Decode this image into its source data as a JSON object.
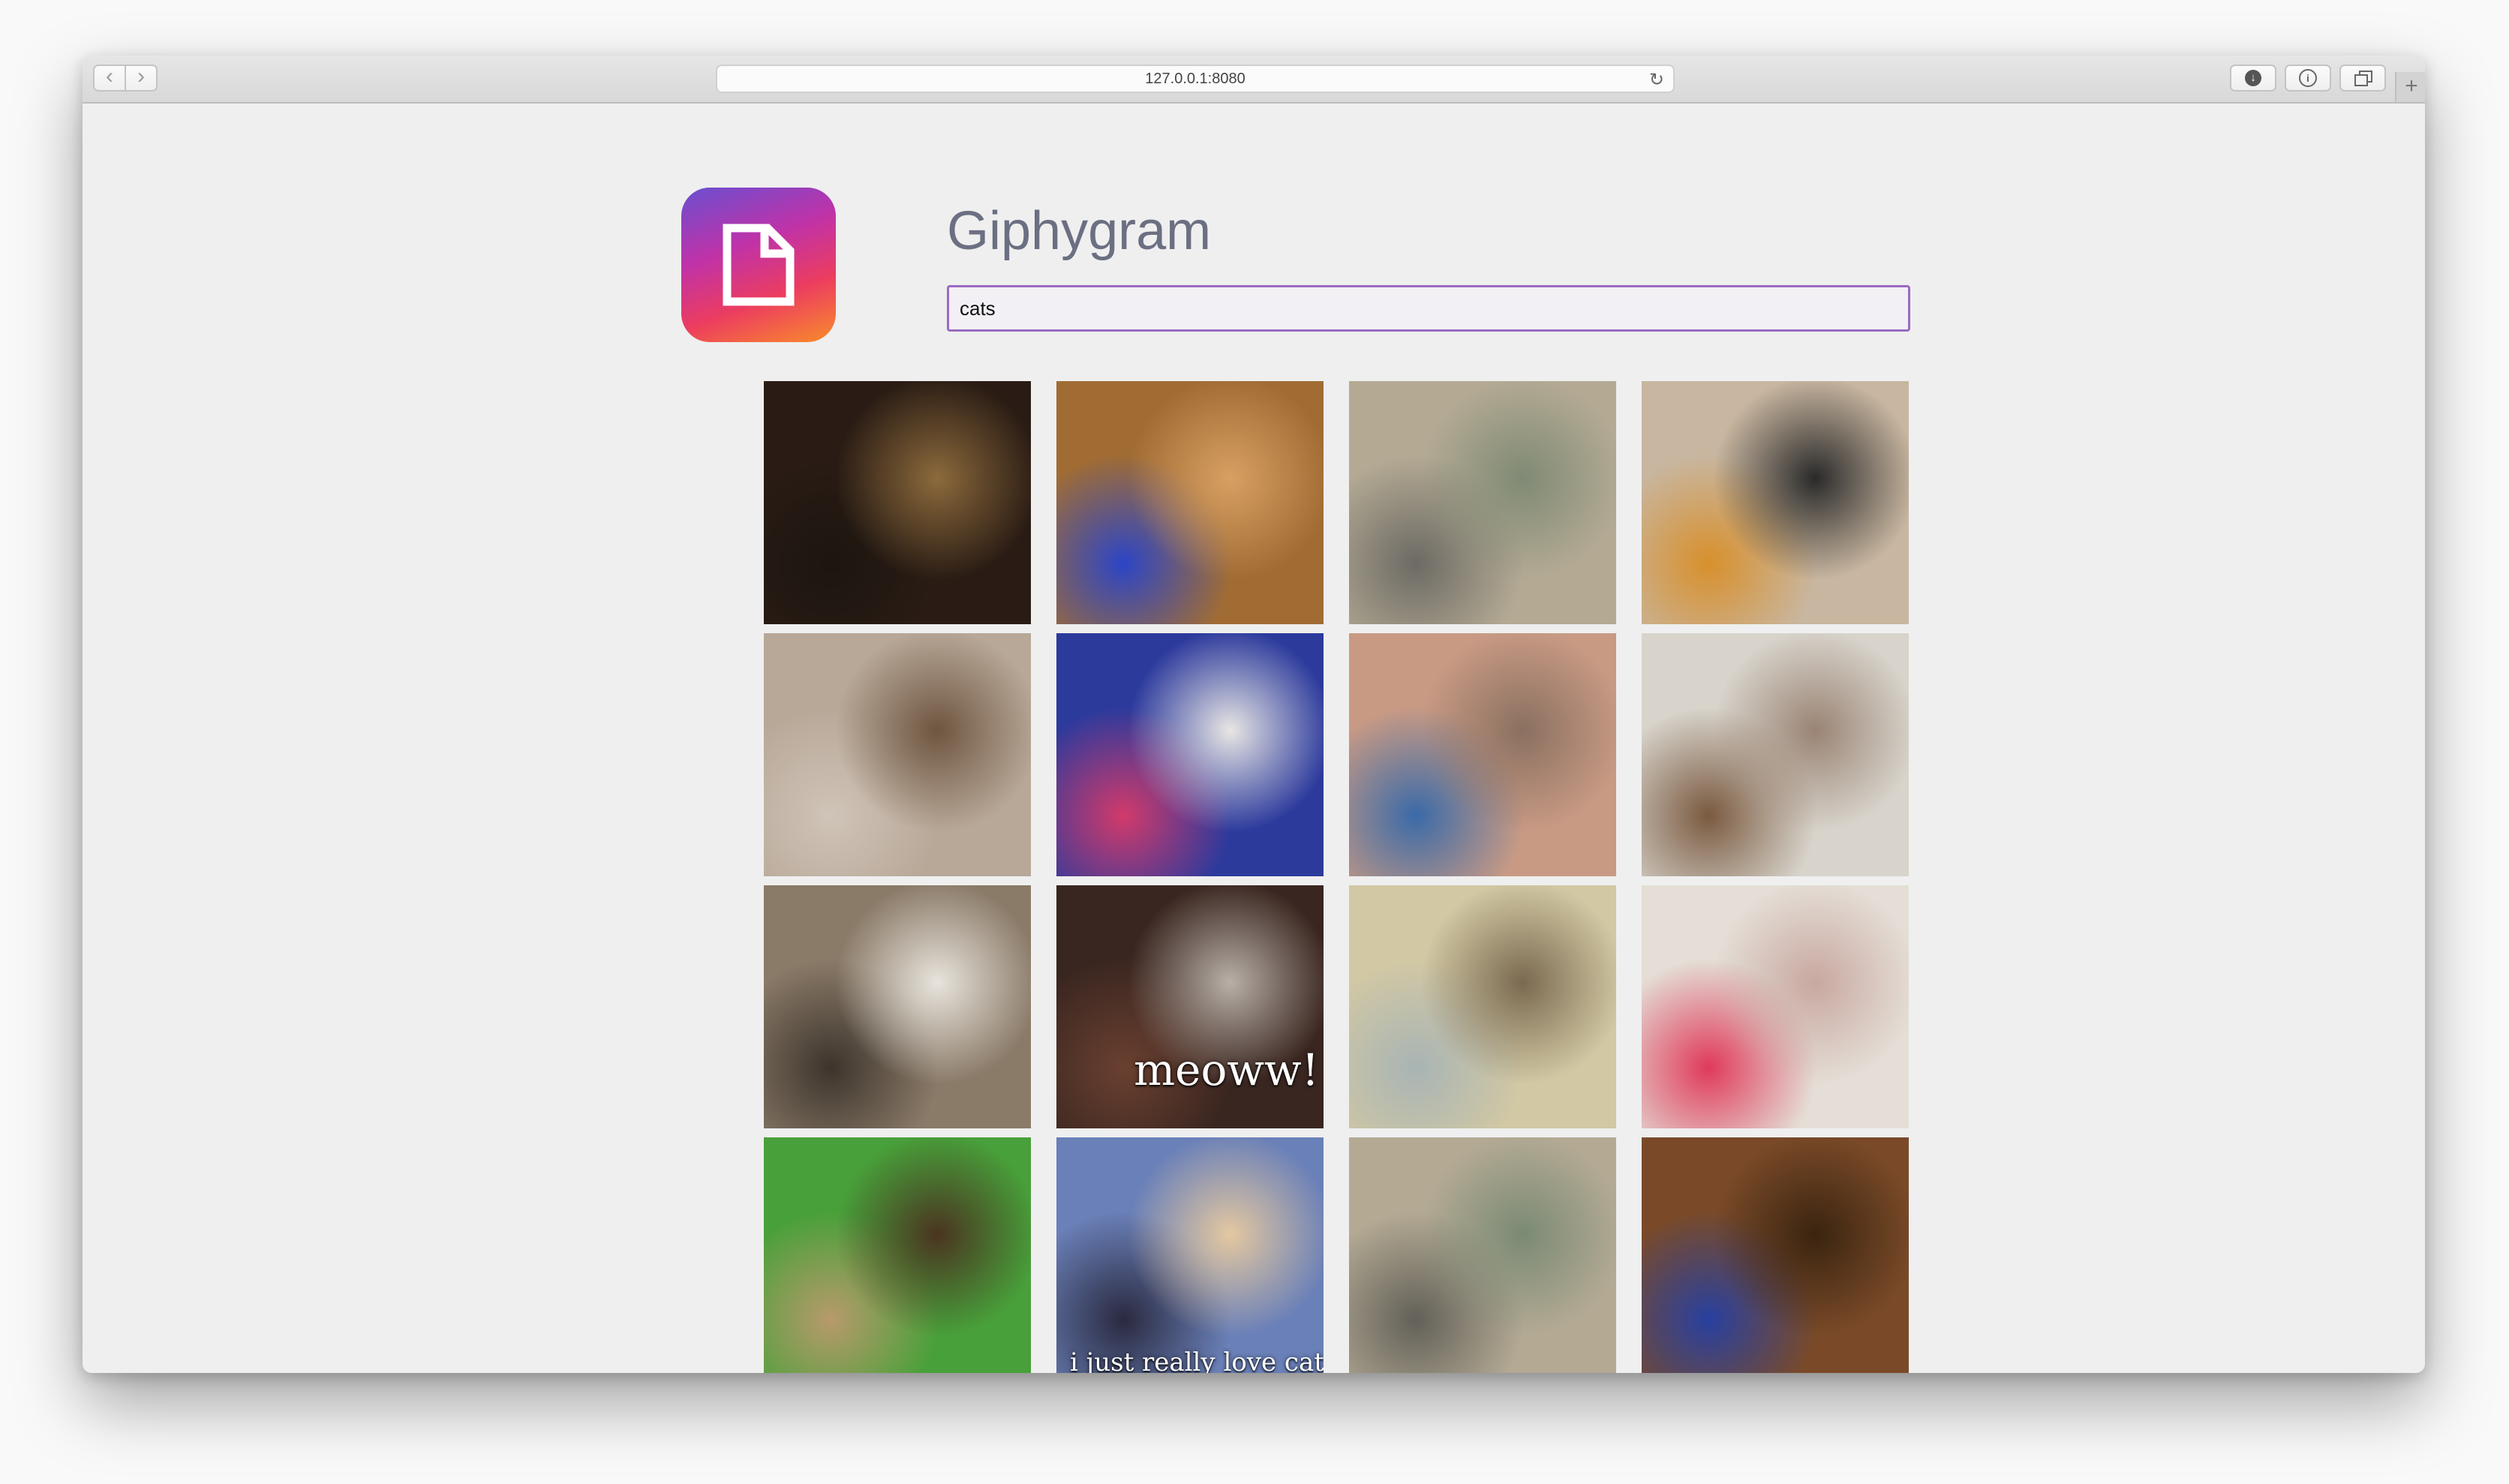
{
  "browser": {
    "url": "127.0.0.1:8080",
    "icons": [
      "back-icon",
      "forward-icon",
      "reload-icon",
      "download-icon",
      "info-icon",
      "tabs-icon",
      "new-tab-icon"
    ]
  },
  "app": {
    "title": "Giphygram",
    "logo_icon": "document-icon",
    "search": {
      "value": "cats",
      "placeholder": ""
    }
  },
  "gifs": [
    {
      "caption": "",
      "colors": [
        "#2a1c14",
        "#8c6a3c",
        "#1c1510"
      ]
    },
    {
      "caption": "",
      "colors": [
        "#a06c34",
        "#d8a062",
        "#2c45c6"
      ]
    },
    {
      "caption": "",
      "colors": [
        "#b4aa94",
        "#7f8a74",
        "#6c6a64"
      ]
    },
    {
      "caption": "",
      "colors": [
        "#c8b6a0",
        "#2a2a2a",
        "#d8902c"
      ]
    },
    {
      "caption": "",
      "colors": [
        "#b8a898",
        "#6e5640",
        "#d0c4b8"
      ]
    },
    {
      "caption": "",
      "colors": [
        "#2c3a9c",
        "#e8e6e4",
        "#d23a6a"
      ]
    },
    {
      "caption": "",
      "colors": [
        "#c89a84",
        "#8a7060",
        "#3a6aa8"
      ]
    },
    {
      "caption": "",
      "colors": [
        "#d8d4cc",
        "#9a8474",
        "#7a5a40"
      ]
    },
    {
      "caption": "",
      "colors": [
        "#8a7a68",
        "#e8e4dc",
        "#3c342c"
      ]
    },
    {
      "caption": "meoww!",
      "colors": [
        "#3a2620",
        "#b8b0a8",
        "#6a4030"
      ]
    },
    {
      "caption": "",
      "colors": [
        "#d2c8a4",
        "#7a6a50",
        "#a8b4b4"
      ]
    },
    {
      "caption": "",
      "colors": [
        "#e4ded6",
        "#c8a8a0",
        "#e03a5a"
      ]
    },
    {
      "caption": "",
      "colors": [
        "#48a03a",
        "#4a3420",
        "#b89a6a"
      ]
    },
    {
      "caption": "i just really love cats",
      "colors": [
        "#6a80b8",
        "#e4c8a0",
        "#2a2a40"
      ]
    },
    {
      "caption": "",
      "colors": [
        "#b4aa94",
        "#7a8a74",
        "#626058"
      ]
    },
    {
      "caption": "",
      "colors": [
        "#7a4a28",
        "#3a2410",
        "#2840a0"
      ]
    },
    {
      "caption": "",
      "colors": [
        "#c06a28",
        "#e8a050",
        "#6a3010"
      ]
    },
    {
      "caption": "",
      "colors": [
        "#c8a48c",
        "#a08068",
        "#d8c0a8"
      ]
    },
    {
      "caption": "",
      "colors": [
        "#2a3040",
        "#e0e4ec",
        "#4a5468"
      ]
    },
    {
      "caption": "",
      "colors": [
        "#2e5a50",
        "#2a4a44",
        "#386a5c"
      ]
    }
  ]
}
